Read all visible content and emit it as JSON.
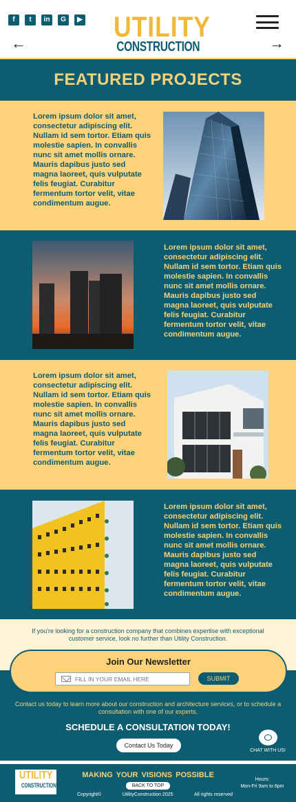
{
  "header": {
    "social_icons": [
      "facebook-icon",
      "twitter-icon",
      "linkedin-icon",
      "google-icon",
      "youtube-icon"
    ],
    "logo_line1": "UTILITY",
    "logo_line2": "CONSTRUCTION",
    "back_arrow": "←",
    "forward_arrow": "→"
  },
  "title": "FEATURED PROJECTS",
  "projects": [
    {
      "text": "Lorem ipsum dolor sit amet, consectetur adipiscing elit. Nullam id sem tortor. Etiam quis molestie sapien. In  convallis nunc sit amet mollis ornare. Mauris dapibus justo sed magna laoreet, quis vulputate felis feugiat. Curabitur fermentum tortor velit, vitae condimentum augue."
    },
    {
      "text": "Lorem ipsum dolor sit amet, consectetur adipiscing elit. Nullam id sem tortor. Etiam quis molestie sapien. In  convallis nunc sit amet mollis ornare. Mauris dapibus justo sed magna laoreet, quis vulputate felis feugiat. Curabitur fermentum tortor velit, vitae condimentum augue."
    },
    {
      "text": "Lorem ipsum dolor sit amet, consectetur adipiscing elit. Nullam id sem tortor. Etiam quis molestie sapien. In  convallis nunc sit amet mollis ornare. Mauris dapibus justo sed magna laoreet, quis vulputate felis feugiat. Curabitur fermentum tortor velit, vitae condimentum augue."
    },
    {
      "text": "Lorem ipsum dolor sit amet, consectetur adipiscing elit. Nullam id sem tortor. Etiam quis molestie sapien. In  convallis nunc sit amet mollis ornare. Mauris dapibus justo sed magna laoreet, quis vulputate felis feugiat. Curabitur fermentum tortor velit, vitae condimentum augue."
    }
  ],
  "intro_text": "If you're looking for a construction company that combines expertise with exceptional customer service, look no further than Utility Construction.",
  "newsletter": {
    "title": "Join Our Newsletter",
    "placeholder": "FILL IN YOUR EMAIL HERE",
    "submit_label": "SUBMIT"
  },
  "contact": {
    "text": "Contact us today to learn more about our construction and architecture services, or to schedule a consultation with one of our experts.",
    "schedule_heading": "SCHEDULE A CONSULTATION TODAY!",
    "button_label": "Contact Us Today",
    "chat_label": "CHAT WITH US!"
  },
  "footer": {
    "logo_line1": "UTILITY",
    "logo_line2": "CONSTRUCTION",
    "tagline": "MAKING  YOUR VISIONS  POSSIBLE",
    "back_to_top": "BACK TO TOP",
    "copyright_label": "Copyright©",
    "copyright_name": "UtilityConstruction 2025",
    "rights": "All rights reserved",
    "hours_label": "Hours:",
    "hours_value": "Mon-Fri 9am to 6pm"
  },
  "colors": {
    "teal": "#0d5c70",
    "yellow": "#fcd27a",
    "cream": "#fff3d6"
  }
}
